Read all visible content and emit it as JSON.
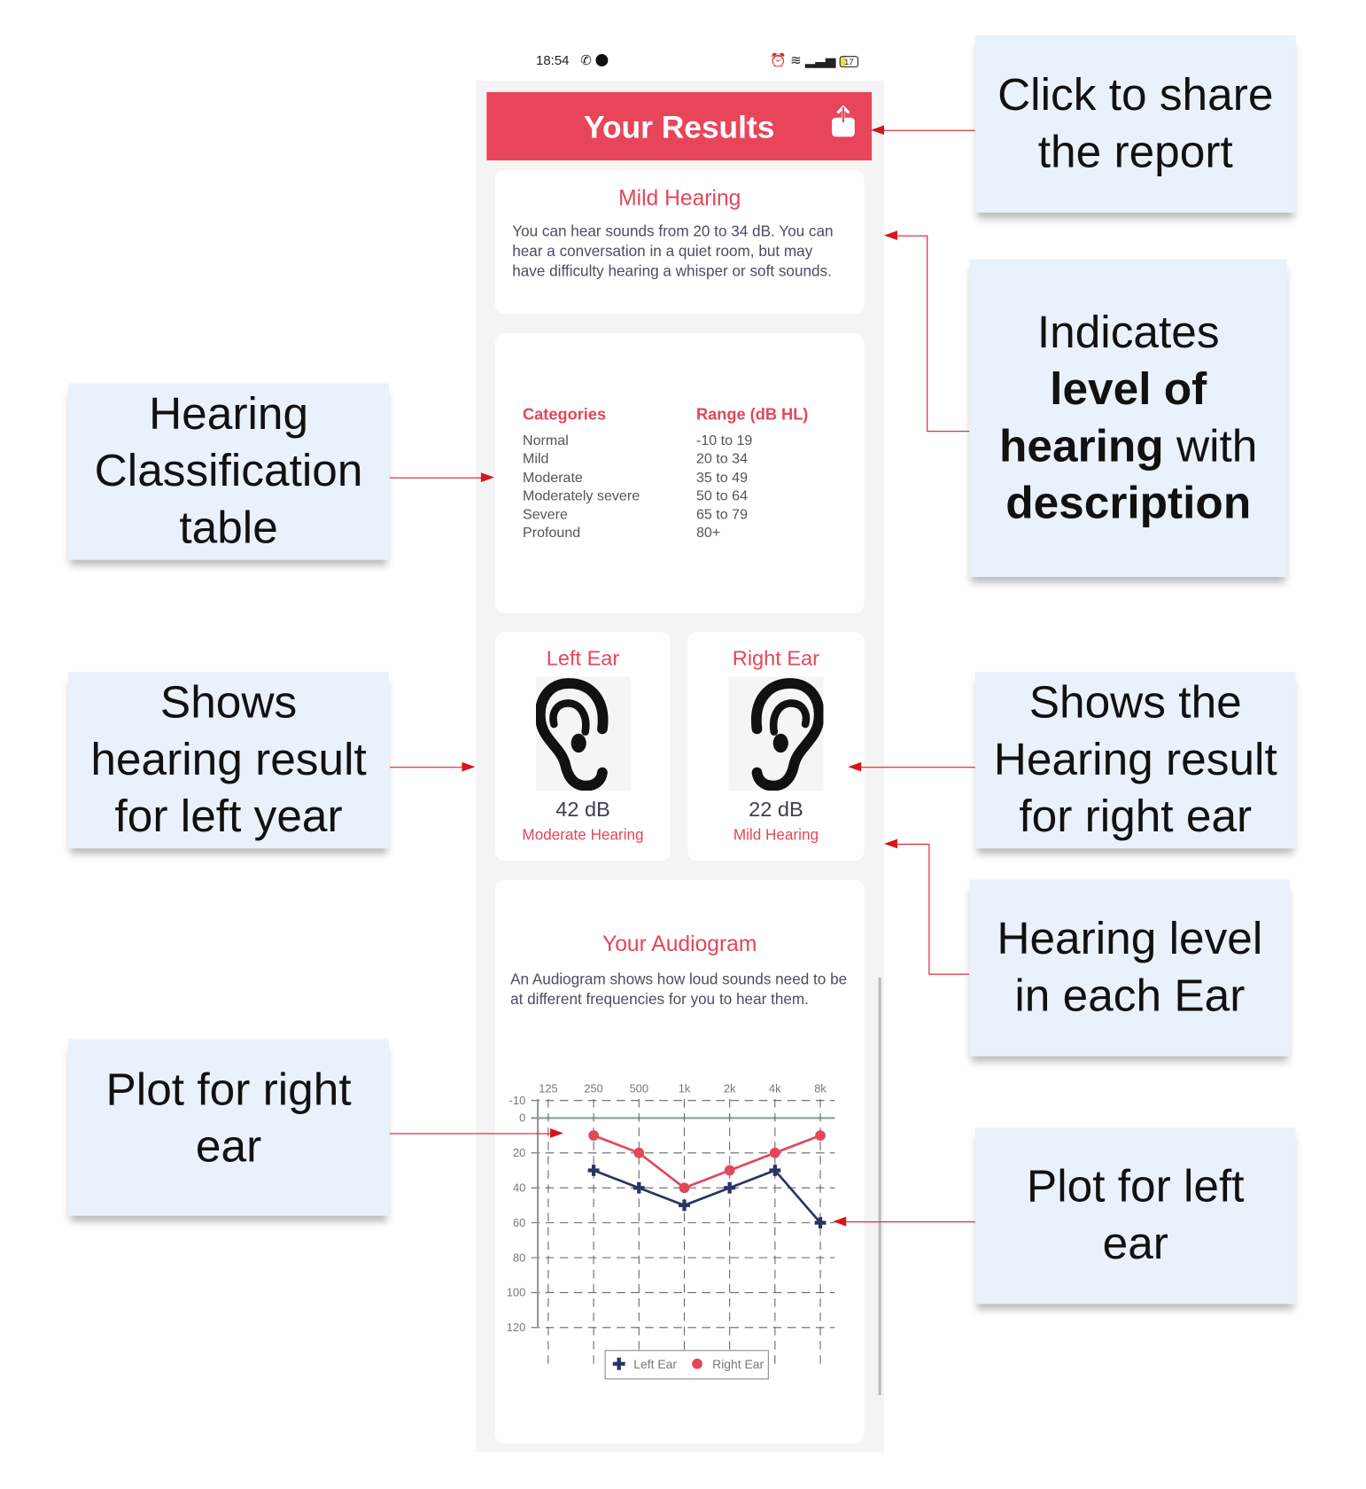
{
  "status_bar": {
    "time": "18:54",
    "battery": "17"
  },
  "header": {
    "title": "Your Results",
    "share_icon": "share-icon"
  },
  "level_card": {
    "title": "Mild Hearing",
    "description": "You can hear sounds from 20 to 34 dB. You can hear a conversation in a quiet room, but may have difficulty hearing a whisper or soft sounds."
  },
  "classification": {
    "headers": [
      "Categories",
      "Range (dB HL)"
    ],
    "rows": [
      [
        "Normal",
        "-10 to 19"
      ],
      [
        "Mild",
        "20 to 34"
      ],
      [
        "Moderate",
        "35 to 49"
      ],
      [
        "Moderately severe",
        "50 to 64"
      ],
      [
        "Severe",
        "65 to 79"
      ],
      [
        "Profound",
        "80+"
      ]
    ]
  },
  "ears": [
    {
      "title": "Left Ear",
      "value": "42 dB",
      "level": "Moderate Hearing"
    },
    {
      "title": "Right Ear",
      "value": "22 dB",
      "level": "Mild Hearing"
    }
  ],
  "audiogram": {
    "title": "Your Audiogram",
    "description": "An Audiogram shows how loud sounds need to be at different frequencies for you to hear them."
  },
  "chart_data": {
    "type": "line",
    "x": [
      "125",
      "250",
      "500",
      "1k",
      "2k",
      "4k",
      "8k"
    ],
    "yticks": [
      -10,
      0,
      20,
      40,
      60,
      80,
      100,
      120
    ],
    "ylim": [
      -10,
      120
    ],
    "y_inverted": true,
    "grid": true,
    "legend": "bottom",
    "series": [
      {
        "name": "Left Ear",
        "marker": "cross",
        "color": "#2a3366",
        "values": [
          null,
          30,
          40,
          50,
          40,
          30,
          60
        ]
      },
      {
        "name": "Right Ear",
        "marker": "circle",
        "color": "#e2475a",
        "values": [
          null,
          10,
          20,
          40,
          30,
          20,
          10
        ]
      }
    ]
  },
  "annotations": {
    "share": "Click to share the report",
    "level_a": "Indicates",
    "level_b": "level of hearing",
    "level_c": " with ",
    "level_d": "description",
    "table": "Hearing Classification table",
    "left": "Shows hearing result for left year",
    "right": "Shows the Hearing result for right ear",
    "each": "Hearing level in each Ear",
    "plot_right": "Plot for right ear",
    "plot_left": "Plot for left ear"
  }
}
